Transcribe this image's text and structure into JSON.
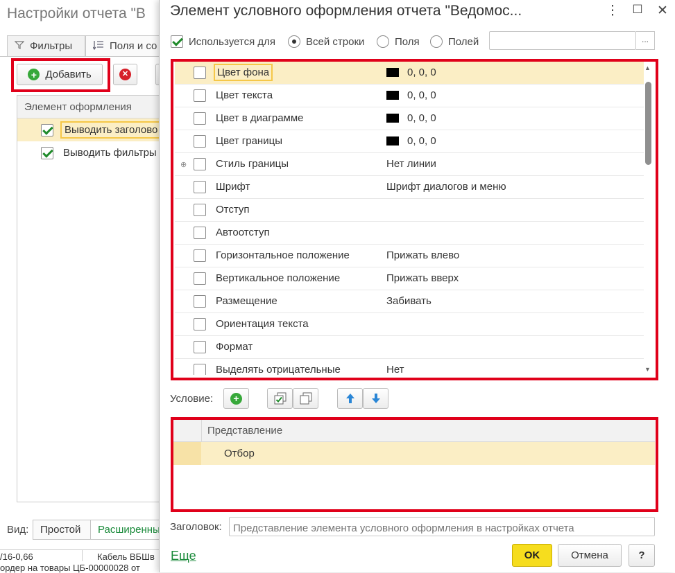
{
  "background": {
    "title": "Настройки отчета \"В",
    "tabs": [
      "Фильтры",
      "Поля и со"
    ],
    "add_label": "Добавить",
    "table_header": "Элемент оформления",
    "rows": [
      {
        "label": "Выводить заголово",
        "checked": true
      },
      {
        "label": "Выводить фильтры",
        "checked": true
      }
    ],
    "view_label": "Вид:",
    "view_options": [
      "Простой",
      "Расширенны"
    ],
    "strip_cells": [
      "/16-0,66",
      "Кабель ВБШв",
      "ордер на товары ЦБ-00000028 от"
    ]
  },
  "dialog": {
    "title": "Элемент условного оформления отчета \"Ведомос...",
    "used_for_label": "Используется для",
    "used_for_checked": true,
    "scope_options": [
      {
        "label": "Всей строки",
        "selected": true
      },
      {
        "label": "Поля",
        "selected": false
      },
      {
        "label": "Полей",
        "selected": false
      }
    ],
    "fields_btn": "...",
    "properties": [
      {
        "name": "Цвет фона",
        "value": "0, 0, 0",
        "swatch": "#000000",
        "selected": true
      },
      {
        "name": "Цвет текста",
        "value": "0, 0, 0",
        "swatch": "#000000"
      },
      {
        "name": "Цвет в диаграмме",
        "value": "0, 0, 0",
        "swatch": "#000000"
      },
      {
        "name": "Цвет границы",
        "value": "0, 0, 0",
        "swatch": "#000000"
      },
      {
        "name": "Стиль границы",
        "value": "Нет линии",
        "expand": "⊕"
      },
      {
        "name": "Шрифт",
        "value": "Шрифт диалогов и меню"
      },
      {
        "name": "Отступ",
        "value": ""
      },
      {
        "name": "Автоотступ",
        "value": ""
      },
      {
        "name": "Горизонтальное положение",
        "value": "Прижать влево"
      },
      {
        "name": "Вертикальное положение",
        "value": "Прижать вверх"
      },
      {
        "name": "Размещение",
        "value": "Забивать"
      },
      {
        "name": "Ориентация текста",
        "value": ""
      },
      {
        "name": "Формат",
        "value": ""
      },
      {
        "name": "Выделять отрицательные",
        "value": "Нет"
      }
    ],
    "condition_label": "Условие:",
    "condition_header": "Представление",
    "condition_row": "Отбор",
    "header_label": "Заголовок:",
    "header_placeholder": "Представление элемента условного оформления в настройках отчета",
    "more_link": "Еще",
    "ok_label": "OK",
    "cancel_label": "Отмена",
    "help_label": "?",
    "accent_color": "#f6dd1e",
    "highlight_color": "#e0001a"
  }
}
